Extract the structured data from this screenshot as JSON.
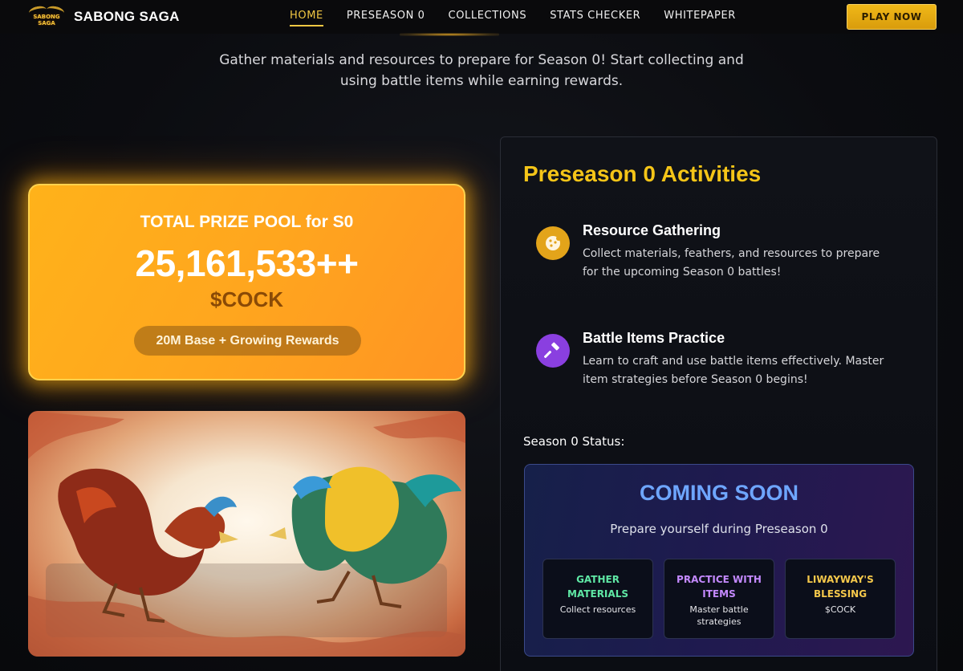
{
  "brand": {
    "logo_text": "SABONG SAGA",
    "name": "SABONG SAGA"
  },
  "nav": {
    "items": [
      {
        "label": "HOME",
        "active": true
      },
      {
        "label": "PRESEASON 0",
        "active": false
      },
      {
        "label": "COLLECTIONS",
        "active": false
      },
      {
        "label": "STATS CHECKER",
        "active": false
      },
      {
        "label": "WHITEPAPER",
        "active": false
      }
    ],
    "cta": "PLAY NOW"
  },
  "intro": {
    "line1": "Gather materials and resources to prepare for Season 0! Start collecting and",
    "line2": "using battle items while earning rewards."
  },
  "prize": {
    "title": "TOTAL PRIZE POOL for S0",
    "amount": "25,161,533++",
    "unit": "$COCK",
    "pill": "20M Base + Growing Rewards"
  },
  "activities": {
    "title": "Preseason 0 Activities",
    "items": [
      {
        "icon": "cookie-icon",
        "title": "Resource Gathering",
        "desc1": "Collect materials, feathers, and resources to prepare",
        "desc2": "for the upcoming Season 0 battles!"
      },
      {
        "icon": "hammer-icon",
        "title": "Battle Items Practice",
        "desc1": "Learn to craft and use battle items effectively. Master",
        "desc2": "item strategies before Season 0 begins!"
      }
    ],
    "status_label": "Season 0 Status:",
    "status": {
      "headline": "COMING SOON",
      "subtitle": "Prepare yourself during Preseason 0",
      "cards": [
        {
          "title1": "GATHER",
          "title2": "MATERIALS",
          "desc1": "Collect resources",
          "desc2": "",
          "color": "#5fe8a5"
        },
        {
          "title1": "PRACTICE WITH",
          "title2": "ITEMS",
          "desc1": "Master battle",
          "desc2": "strategies",
          "color": "#c489ff"
        },
        {
          "title1": "LIWAYWAY'S",
          "title2": "BLESSING",
          "desc1": "$COCK",
          "desc2": "",
          "color": "#f5c84b"
        }
      ]
    }
  },
  "colors": {
    "accent": "#f5c518",
    "nav_active": "#f2c843",
    "status_blue": "#6ea6ff"
  }
}
